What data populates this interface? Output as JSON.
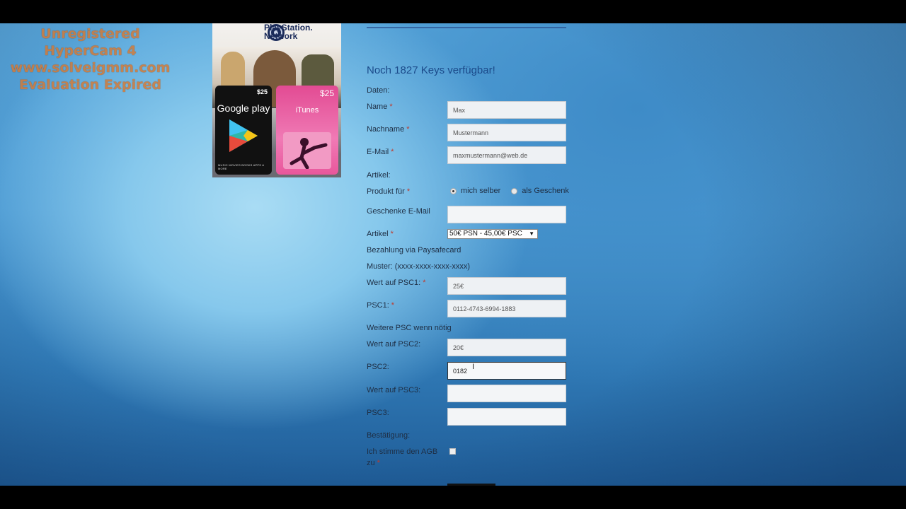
{
  "watermark": {
    "line1": "Unregistered HyperCam 4",
    "line2": "www.solveigmm.com",
    "line3": "Evaluation Expired"
  },
  "promo": {
    "psn_text": "PlayStation. Network",
    "google_price": "$25",
    "google_label": "Google play",
    "google_small": "MUSIC MOVIES BOOKS APPS & MORE",
    "itunes_price": "$25",
    "itunes_label": "iTunes"
  },
  "form": {
    "title": "Noch 1827 Keys verfügbar!",
    "section_daten": "Daten:",
    "name_label": "Name",
    "name_value": "Max",
    "nachname_label": "Nachname",
    "nachname_value": "Mustermann",
    "email_label": "E-Mail",
    "email_value": "maxmustermann@web.de",
    "section_artikel": "Artikel:",
    "produkt_label": "Produkt für",
    "radio_option1": "mich selber",
    "radio_option2": "als Geschenk",
    "radio_selected": "mich selber",
    "geschenk_label": "Geschenke E-Mail",
    "geschenk_value": "",
    "artikel_label": "Artikel",
    "artikel_selected": "50€ PSN - 45,00€ PSC",
    "bezahlung": "Bezahlung via Paysafecard",
    "muster": "Muster: (xxxx-xxxx-xxxx-xxxx)",
    "wert1_label": "Wert auf PSC1:",
    "wert1_value": "25€",
    "psc1_label": "PSC1:",
    "psc1_value": "0112-4743-6994-1883",
    "weitere": "Weitere PSC wenn nötig",
    "wert2_label": "Wert auf PSC2:",
    "wert2_value": "20€",
    "psc2_label": "PSC2:",
    "psc2_value": "0182",
    "wert3_label": "Wert auf PSC3:",
    "wert3_value": "",
    "psc3_label": "PSC3:",
    "psc3_value": "",
    "bestaetigung": "Bestätigung:",
    "agb_label": "Ich stimme den AGB zu",
    "required_mark": "*"
  }
}
